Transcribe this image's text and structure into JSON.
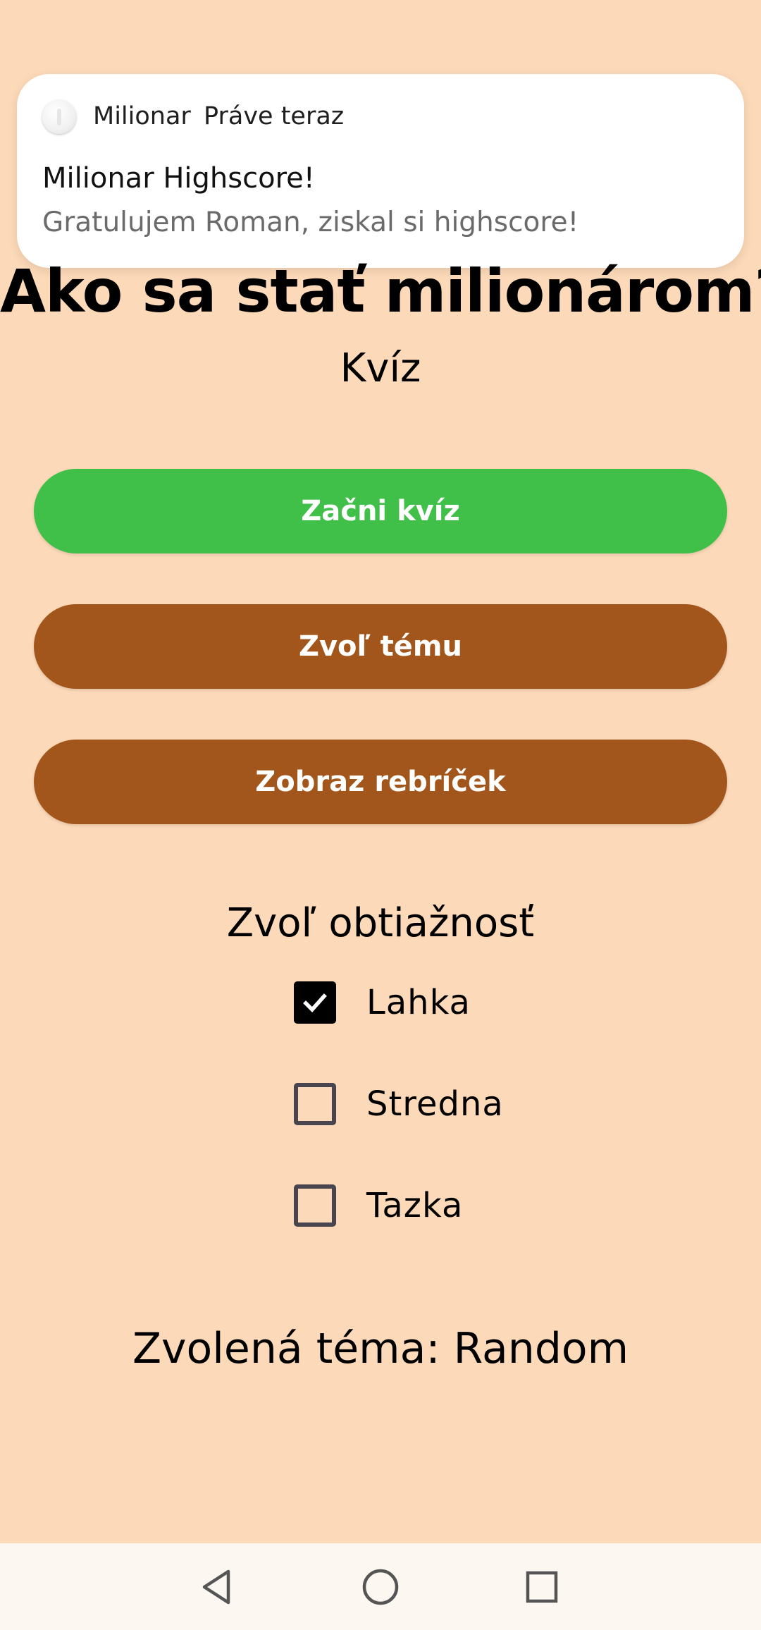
{
  "notification": {
    "app_name": "Milionar",
    "time": "Práve teraz",
    "title": "Milionar Highscore!",
    "body": "Gratulujem Roman, ziskal si highscore!",
    "icon": "app-icon"
  },
  "header": {
    "title": "Ako sa stať milionárom?",
    "subtitle": "Kvíz"
  },
  "buttons": {
    "start": "Začni kvíz",
    "choose_topic": "Zvoľ tému",
    "leaderboard": "Zobraz rebríček"
  },
  "difficulty": {
    "title": "Zvoľ obtiažnosť",
    "options": [
      {
        "label": "Lahka",
        "checked": true
      },
      {
        "label": "Stredna",
        "checked": false
      },
      {
        "label": "Tazka",
        "checked": false
      }
    ]
  },
  "topic": {
    "text": "Zvolená téma: Random"
  },
  "navbar": {
    "back_icon": "back-triangle-icon",
    "home_icon": "home-circle-icon",
    "recents_icon": "recents-square-icon"
  },
  "colors": {
    "background": "#fcd9b8",
    "start_button": "#40c048",
    "secondary_button": "#a3561b",
    "navbar": "#fdf7f2"
  }
}
